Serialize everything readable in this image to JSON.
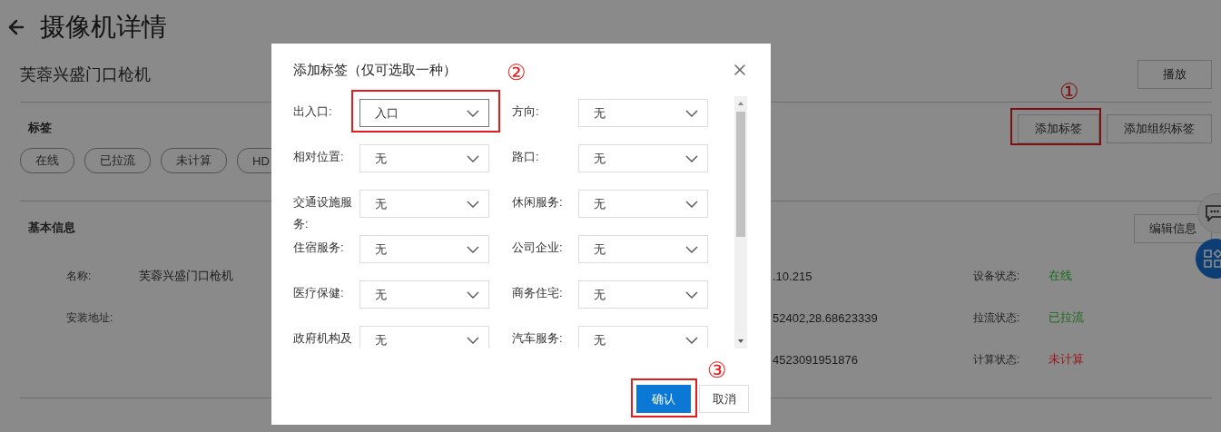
{
  "page": {
    "title": "摄像机详情"
  },
  "camera": {
    "name": "芙蓉兴盛门口枪机",
    "play_button": "播放"
  },
  "tags_section": {
    "title": "标签",
    "buttons": [
      {
        "label": "添加标签",
        "annotation": "①"
      },
      {
        "label": "添加组织标签"
      }
    ],
    "tags": [
      "在线",
      "已拉流",
      "未计算",
      "HD"
    ]
  },
  "basic_info": {
    "title": "基本信息",
    "edit_button": "编辑信息",
    "rows": [
      {
        "label": "名称:",
        "value": "芙蓉兴盛门口枪机",
        "column_3": ".10.215",
        "status_label": "设备状态:",
        "status": "在线",
        "color": "#1c6b1c"
      },
      {
        "label": "安装地址:",
        "column_3": "52402,28.68623339",
        "status_label": "拉流状态:",
        "status": "已拉流",
        "color": "#1c6b1c"
      },
      {
        "column_3": "4523091951876",
        "status_label": "计算状态:",
        "status": "未计算",
        "color": "#9c1414"
      }
    ]
  },
  "dialog": {
    "title": "添加标签（仅可选取一种）",
    "fields": [
      {
        "label": "出入口:",
        "value": "入口",
        "annotation": "②"
      },
      {
        "label": "方向:",
        "value": "无"
      },
      {
        "label": "相对位置:",
        "value": "无"
      },
      {
        "label": "路口:",
        "value": "无"
      },
      {
        "label": "交通设施服务:",
        "value": "无"
      },
      {
        "label": "休闲服务:",
        "value": "无"
      },
      {
        "label": "住宿服务:",
        "value": "无"
      },
      {
        "label": "公司企业:",
        "value": "无"
      },
      {
        "label": "医疗保健:",
        "value": "无"
      },
      {
        "label": "商务住宅:",
        "value": "无"
      },
      {
        "label": "政府机构及",
        "value": "无"
      },
      {
        "label": "汽车服务:",
        "value": "无"
      }
    ],
    "confirm_button": {
      "label": "确认",
      "annotation": "③"
    },
    "cancel_button": "取消"
  }
}
